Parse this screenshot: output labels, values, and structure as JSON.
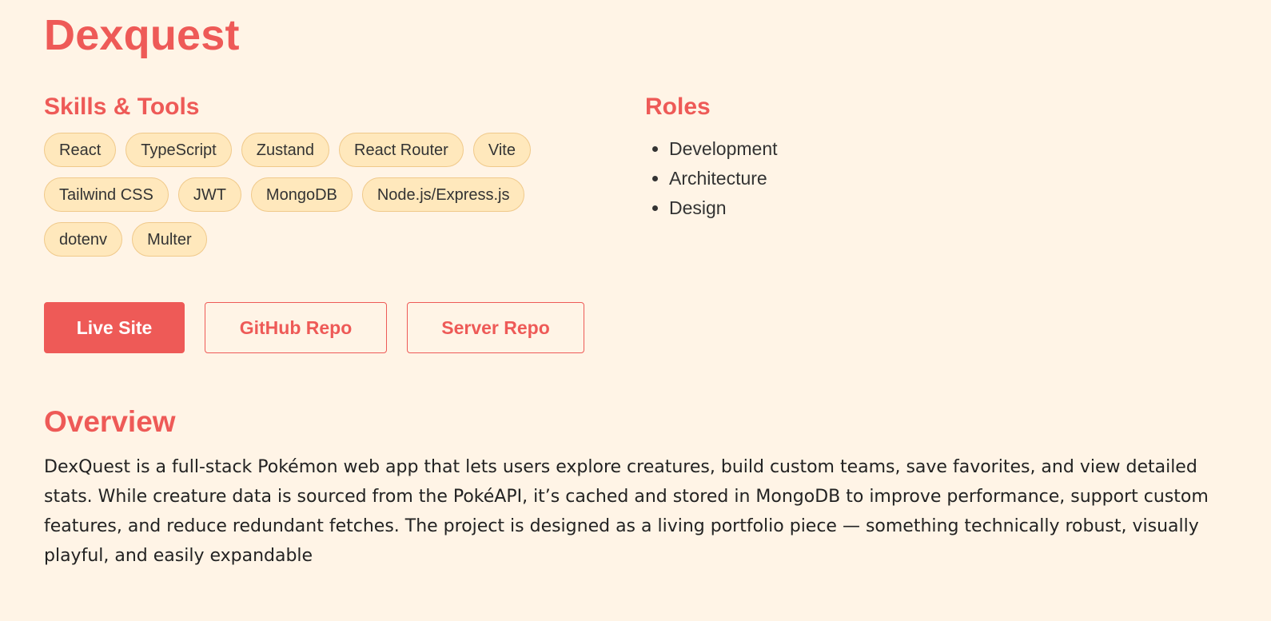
{
  "project": {
    "title": "Dexquest"
  },
  "skills": {
    "heading": "Skills & Tools",
    "items": [
      "React",
      "TypeScript",
      "Zustand",
      "React Router",
      "Vite",
      "Tailwind CSS",
      "JWT",
      "MongoDB",
      "Node.js/Express.js",
      "dotenv",
      "Multer"
    ]
  },
  "roles": {
    "heading": "Roles",
    "items": [
      "Development",
      "Architecture",
      "Design"
    ]
  },
  "actions": {
    "live_site": "Live Site",
    "github_repo": "GitHub Repo",
    "server_repo": "Server Repo"
  },
  "overview": {
    "heading": "Overview",
    "text": "DexQuest is a full-stack Pokémon web app that lets users explore creatures, build custom teams, save favorites, and view detailed stats. While creature data is sourced from the PokéAPI, it’s cached and stored in MongoDB to improve performance, support custom features, and reduce redundant fetches. The project is designed as a living portfolio piece — something technically robust, visually playful, and easily expandable"
  },
  "colors": {
    "accent": "#EE5A57",
    "background": "#FFF4E6",
    "chip_background": "#FFE8BC",
    "chip_border": "#F0C98A",
    "text": "#333333"
  }
}
